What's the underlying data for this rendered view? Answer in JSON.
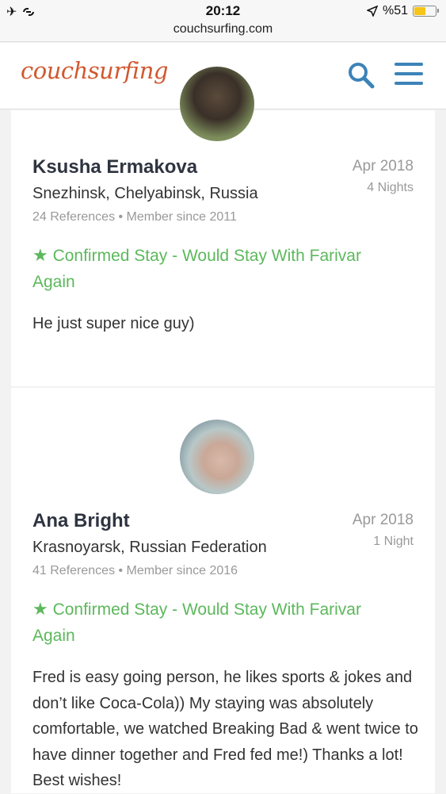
{
  "status_bar": {
    "time": "20:12",
    "battery_text": "%51",
    "battery_level": 0.51,
    "left_icons": [
      "airplane-icon",
      "link-icon"
    ],
    "location_icon": "location-arrow-icon"
  },
  "browser": {
    "url": "couchsurfing.com"
  },
  "header": {
    "logo": "couchsurfing",
    "accent_color": "#d1582f",
    "icon_color": "#3c83b8",
    "search_icon": "search-icon",
    "menu_icon": "hamburger-menu-icon"
  },
  "references": [
    {
      "name": "Ksusha Ermakova",
      "location": "Snezhinsk, Chelyabinsk, Russia",
      "meta": "24 References • Member since 2011",
      "date": "Apr 2018",
      "nights": "4 Nights",
      "confirmed": "Confirmed Stay - Would Stay With Farivar Again",
      "text": "He just super nice guy)"
    },
    {
      "name": "Ana Bright",
      "location": "Krasnoyarsk, Russian Federation",
      "meta": "41 References • Member since 2016",
      "date": "Apr 2018",
      "nights": "1 Night",
      "confirmed": "Confirmed Stay - Would Stay With Farivar Again",
      "text": "Fred is easy going person, he likes sports & jokes and don’t like Coca-Cola)) My staying was absolutely comfortable, we watched Breaking Bad & went twice to have dinner together and Fred fed me!) Thanks a lot! Best wishes!"
    }
  ],
  "confirm_color": "#5cb85c"
}
